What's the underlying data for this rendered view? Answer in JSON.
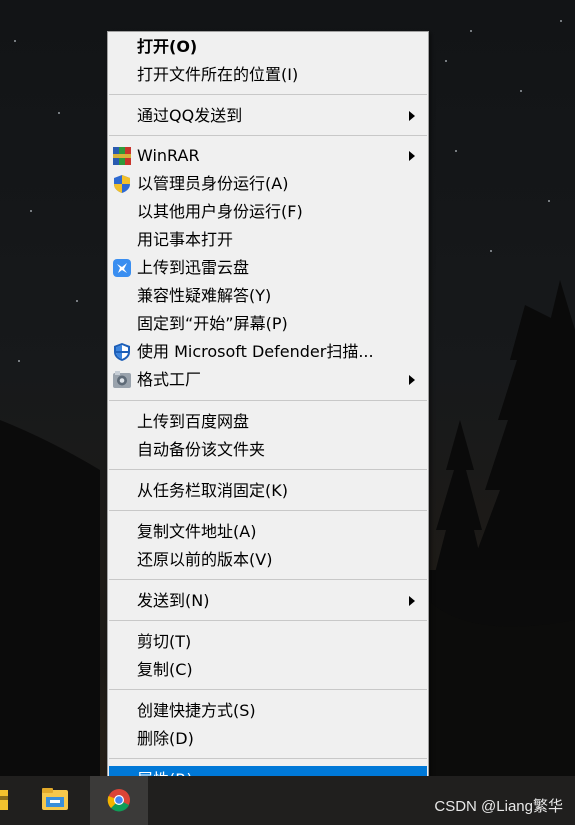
{
  "menu": {
    "items": [
      {
        "label": "打开(O)"
      },
      {
        "label": "打开文件所在的位置(I)"
      },
      {
        "label": "通过QQ发送到"
      },
      {
        "label": "WinRAR"
      },
      {
        "label": "以管理员身份运行(A)"
      },
      {
        "label": "以其他用户身份运行(F)"
      },
      {
        "label": "用记事本打开"
      },
      {
        "label": "上传到迅雷云盘"
      },
      {
        "label": "兼容性疑难解答(Y)"
      },
      {
        "label": "固定到“开始”屏幕(P)"
      },
      {
        "label": "使用 Microsoft Defender扫描..."
      },
      {
        "label": "格式工厂"
      },
      {
        "label": "上传到百度网盘"
      },
      {
        "label": "自动备份该文件夹"
      },
      {
        "label": "从任务栏取消固定(K)"
      },
      {
        "label": "复制文件地址(A)"
      },
      {
        "label": "还原以前的版本(V)"
      },
      {
        "label": "发送到(N)"
      },
      {
        "label": "剪切(T)"
      },
      {
        "label": "复制(C)"
      },
      {
        "label": "创建快捷方式(S)"
      },
      {
        "label": "删除(D)"
      },
      {
        "label": "属性(R)"
      }
    ]
  },
  "taskbar": {
    "icons": [
      "app-icon",
      "file-explorer-icon",
      "chrome-icon"
    ]
  },
  "watermark": "CSDN @Liang繁华",
  "colors": {
    "menu_bg": "#f0f0f0",
    "highlight": "#0078d7",
    "taskbar": "#201f1e"
  }
}
